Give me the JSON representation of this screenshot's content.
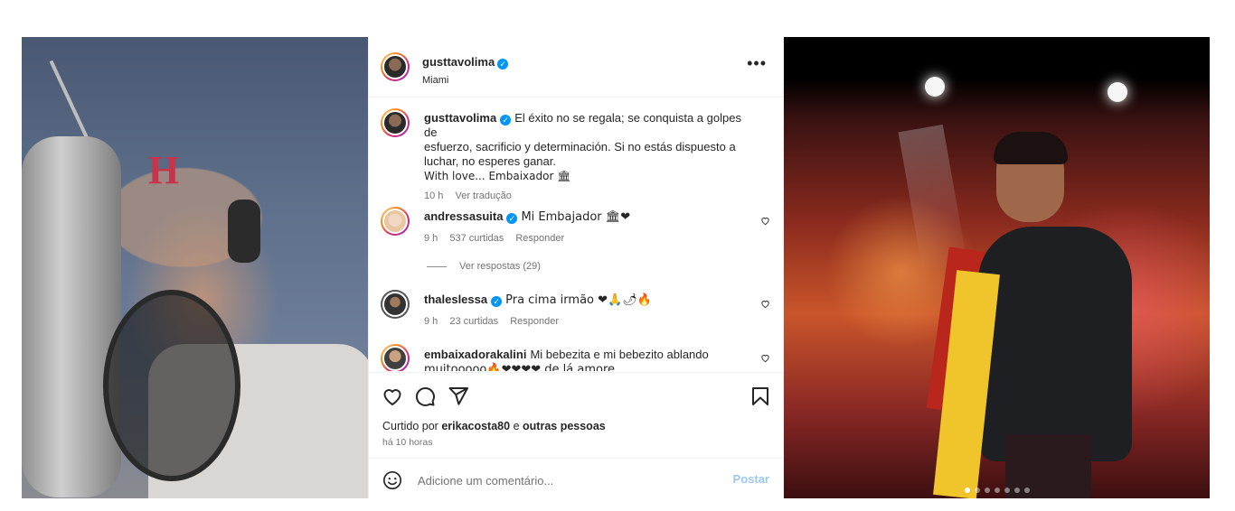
{
  "post": {
    "author": "gusttavolima",
    "location": "Miami",
    "caption_lines": [
      "El éxito no se regala; se conquista a golpes de",
      "esfuerzo, sacrificio y determinación. Si no estás dispuesto a",
      "luchar, no esperes ganar.",
      "With love... Embaixador 🏛"
    ],
    "caption_time": "10 h",
    "see_translation": "Ver tradução"
  },
  "comments": [
    {
      "username": "andressasuita",
      "verified": true,
      "text": "Mi Embajador 🏛❤",
      "time": "9 h",
      "likes": "537 curtidas",
      "reply": "Responder",
      "view_replies": "Ver respostas (29)"
    },
    {
      "username": "thaleslessa",
      "verified": true,
      "text": "Pra cima irmão ❤🙏🌶🔥",
      "time": "9 h",
      "likes": "23 curtidas",
      "reply": "Responder"
    },
    {
      "username": "embaixadorakalini",
      "verified": false,
      "text_line1": "Mi bebezita e mi bebezito ablando",
      "text_line2": "muitooooo🔥❤❤❤❤ de lá amore"
    }
  ],
  "likes_bar": {
    "prefix": "Curtido por",
    "liker": "erikacosta80",
    "conj": "e",
    "others": "outras pessoas",
    "time": "há 10 horas"
  },
  "add_comment": {
    "placeholder": "Adicione um comentário...",
    "post_label": "Postar"
  },
  "left_photo": {
    "cap_letter": "H"
  },
  "carousel": {
    "count": 7,
    "active_index": 0
  },
  "colors": {
    "verified": "#0095f6",
    "post_button": "#9cc8f5",
    "secondary_text": "#737373"
  },
  "icons": [
    "more-options-icon",
    "verified-icon",
    "heart-icon",
    "comment-icon",
    "share-icon",
    "bookmark-icon",
    "emoji-icon"
  ]
}
